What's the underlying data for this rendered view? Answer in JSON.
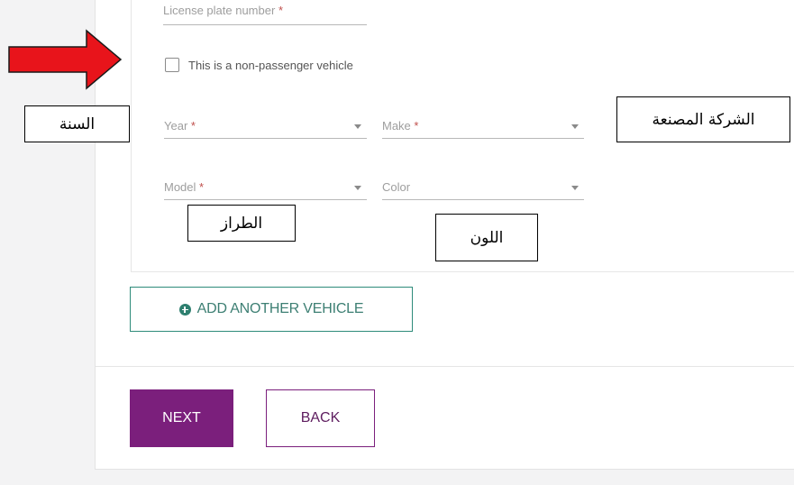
{
  "form": {
    "license_plate": {
      "label": "License plate number",
      "required_mark": "*"
    },
    "non_passenger_checkbox": {
      "label": "This is a non-passenger vehicle",
      "checked": false
    },
    "year": {
      "label": "Year",
      "required_mark": "*"
    },
    "make": {
      "label": "Make",
      "required_mark": "*"
    },
    "model": {
      "label": "Model",
      "required_mark": "*"
    },
    "color": {
      "label": "Color",
      "required_mark": ""
    }
  },
  "buttons": {
    "add_vehicle": "ADD ANOTHER VEHICLE",
    "next": "NEXT",
    "back": "BACK"
  },
  "annotations": {
    "year": "السنة",
    "make": "الشركة المصنعة",
    "model": "الطراز",
    "color": "اللون"
  },
  "colors": {
    "primary_purple": "#7b1f7c",
    "teal": "#2e8b7a",
    "arrow_red": "#e8141b"
  },
  "icons": {
    "add": "plus-circle-icon",
    "pointer": "red-arrow-icon"
  }
}
